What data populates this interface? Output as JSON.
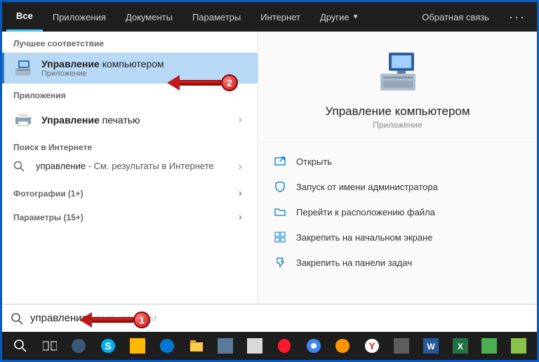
{
  "header": {
    "tabs": [
      "Все",
      "Приложения",
      "Документы",
      "Параметры",
      "Интернет",
      "Другие"
    ],
    "feedback": "Обратная связь"
  },
  "left": {
    "best_match_label": "Лучшее соответствие",
    "best_match": {
      "title_bold": "Управление",
      "title_rest": " компьютером",
      "sub": "Приложение"
    },
    "apps_label": "Приложения",
    "print_mgmt": {
      "title_bold": "Управление",
      "title_rest": " печатью"
    },
    "web_label": "Поиск в Интернете",
    "web_result": {
      "query": "управление",
      "tail": " - См. результаты в Интернете"
    },
    "photos_label": "Фотографии (1+)",
    "params_label": "Параметры (15+)"
  },
  "preview": {
    "title": "Управление компьютером",
    "sub": "Приложение",
    "actions": {
      "open": "Открыть",
      "admin": "Запуск от имени администратора",
      "location": "Перейти к расположению файла",
      "pin_start": "Закрепить на начальном экране",
      "pin_taskbar": "Закрепить на панели задач"
    }
  },
  "search": {
    "value": "управление",
    "typed_rest": "компьютером"
  },
  "annotations": {
    "a1": "1",
    "a2": "2"
  }
}
